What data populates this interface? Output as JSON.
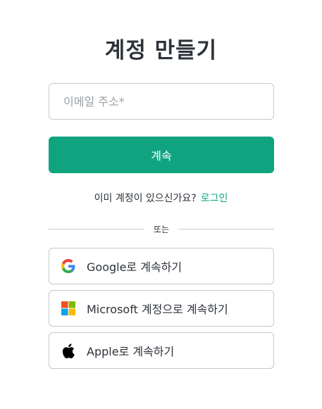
{
  "page": {
    "title": "계정 만들기"
  },
  "form": {
    "email_placeholder": "이메일 주소*",
    "continue_label": "계속"
  },
  "login_prompt": {
    "text": "이미 계정이 있으신가요?",
    "link_label": "로그인"
  },
  "divider": {
    "text": "또는"
  },
  "social": {
    "google_label": "Google로 계속하기",
    "microsoft_label": "Microsoft 계정으로 계속하기",
    "apple_label": "Apple로 계속하기"
  },
  "colors": {
    "accent": "#10a37f",
    "border": "#c2c8d0",
    "text": "#2d333a"
  },
  "icons": {
    "google": "google-logo-icon",
    "microsoft": "microsoft-logo-icon",
    "apple": "apple-logo-icon"
  }
}
